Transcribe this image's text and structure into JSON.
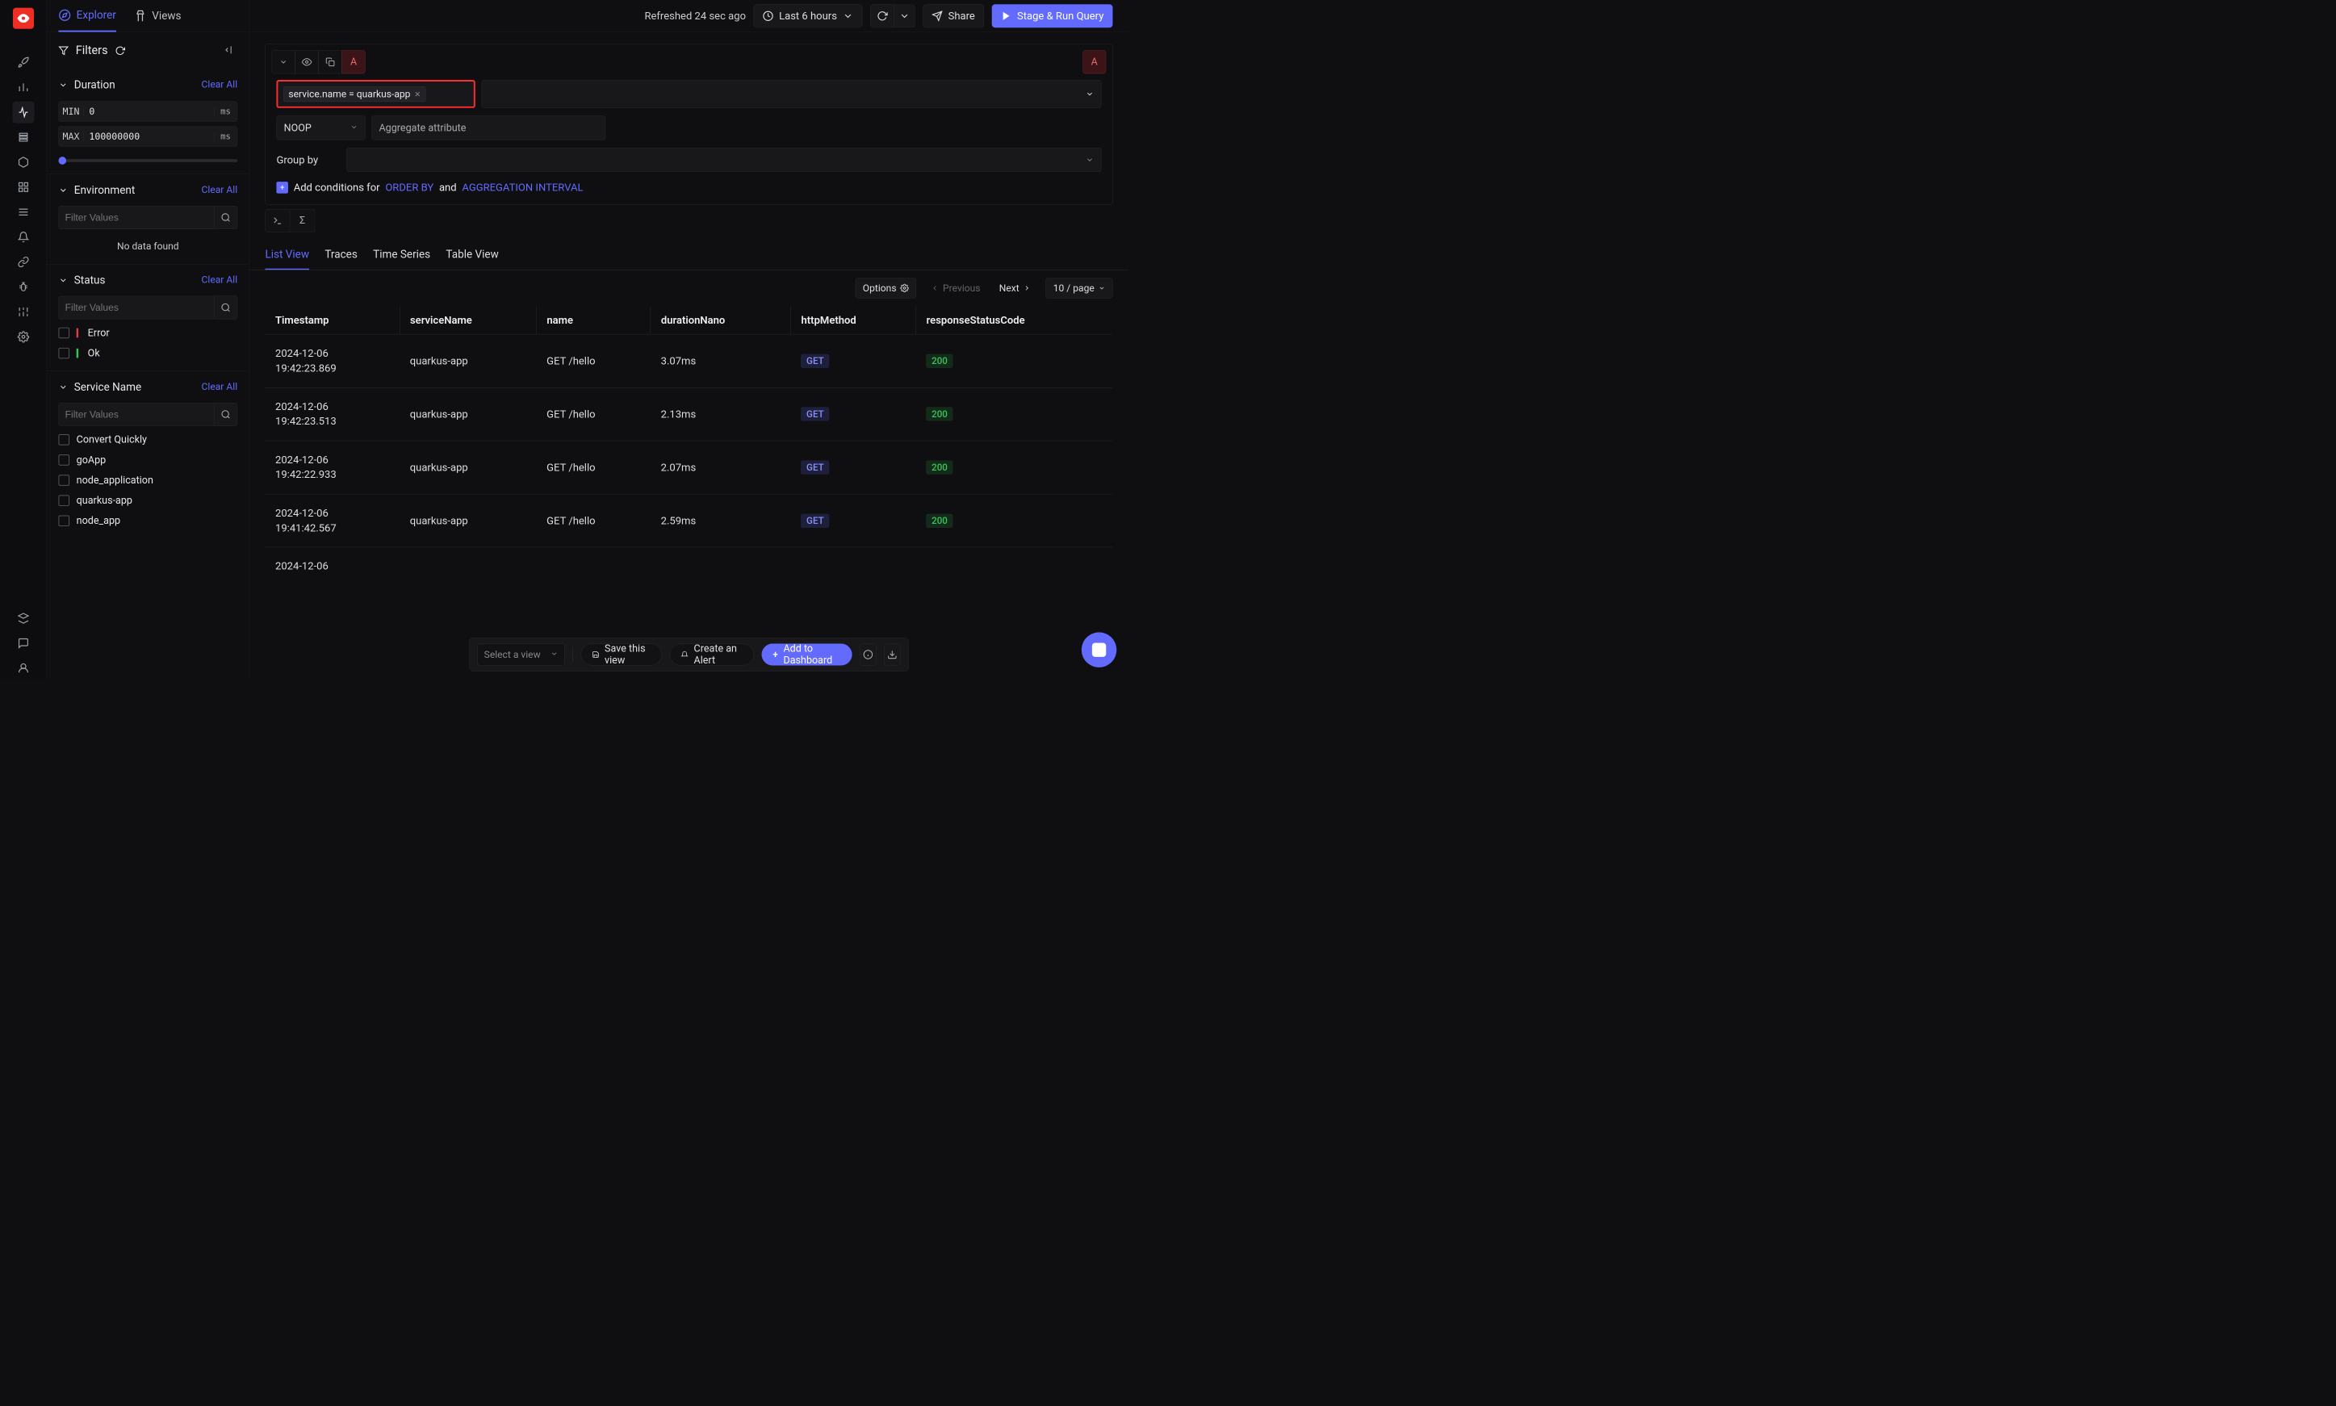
{
  "tabs": {
    "explorer": "Explorer",
    "views": "Views"
  },
  "filters": {
    "label": "Filters",
    "duration": {
      "title": "Duration",
      "clear": "Clear All",
      "min_label": "MIN",
      "min_value": "0",
      "max_label": "MAX",
      "max_value": "100000000",
      "unit": "ms"
    },
    "environment": {
      "title": "Environment",
      "clear": "Clear All",
      "placeholder": "Filter Values",
      "no_data": "No data found"
    },
    "status": {
      "title": "Status",
      "clear": "Clear All",
      "placeholder": "Filter Values",
      "items": [
        "Error",
        "Ok"
      ]
    },
    "service": {
      "title": "Service Name",
      "clear": "Clear All",
      "placeholder": "Filter Values",
      "items": [
        "Convert Quickly",
        "goApp",
        "node_application",
        "quarkus-app",
        "node_app"
      ]
    }
  },
  "toolbar": {
    "refreshed": "Refreshed 24 sec ago",
    "range": "Last 6 hours",
    "share": "Share",
    "stage": "Stage & Run Query"
  },
  "query": {
    "label_a": "A",
    "tag": "service.name = quarkus-app",
    "noop": "NOOP",
    "agg_placeholder": "Aggregate attribute",
    "groupby_label": "Group by",
    "add_prefix": "Add conditions for",
    "orderby": "ORDER BY",
    "and": "and",
    "agg_interval": "AGGREGATION INTERVAL"
  },
  "result_tabs": [
    "List View",
    "Traces",
    "Time Series",
    "Table View"
  ],
  "pagination": {
    "options": "Options",
    "prev": "Previous",
    "next": "Next",
    "perpage": "10 / page"
  },
  "columns": [
    "Timestamp",
    "serviceName",
    "name",
    "durationNano",
    "httpMethod",
    "responseStatusCode"
  ],
  "rows": [
    {
      "ts1": "2024-12-06",
      "ts2": "19:42:23.869",
      "svc": "quarkus-app",
      "name": "GET /hello",
      "dur": "3.07ms",
      "method": "GET",
      "code": "200"
    },
    {
      "ts1": "2024-12-06",
      "ts2": "19:42:23.513",
      "svc": "quarkus-app",
      "name": "GET /hello",
      "dur": "2.13ms",
      "method": "GET",
      "code": "200"
    },
    {
      "ts1": "2024-12-06",
      "ts2": "19:42:22.933",
      "svc": "quarkus-app",
      "name": "GET /hello",
      "dur": "2.07ms",
      "method": "GET",
      "code": "200"
    },
    {
      "ts1": "2024-12-06",
      "ts2": "19:41:42.567",
      "svc": "quarkus-app",
      "name": "GET /hello",
      "dur": "2.59ms",
      "method": "GET",
      "code": "200"
    },
    {
      "ts1": "2024-12-06",
      "ts2": "",
      "svc": "",
      "name": "",
      "dur": "",
      "method": "",
      "code": ""
    }
  ],
  "bottom": {
    "select": "Select a view",
    "save": "Save this view",
    "alert": "Create an Alert",
    "dashboard": "Add to Dashboard"
  }
}
